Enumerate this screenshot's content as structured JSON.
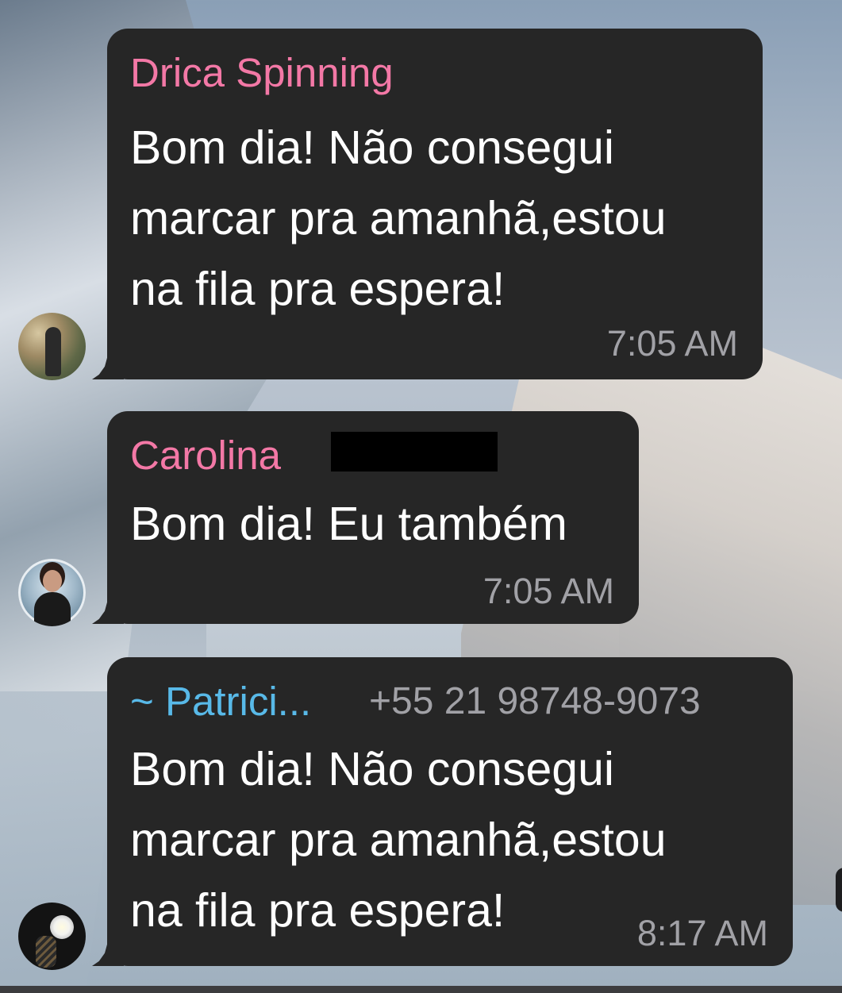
{
  "messages": [
    {
      "sender": "Drica Spinning",
      "text": "Bom dia! Não consegui\nmarcar pra amanhã,estou\nna fila pra espera!",
      "time": "7:05 AM",
      "sender_color": "#f378a6"
    },
    {
      "sender": "Carolina",
      "text": "Bom dia! Eu também",
      "time": "7:05 AM",
      "sender_color": "#f378a6",
      "redacted_surname": true
    },
    {
      "sender": "~ Patrici...",
      "phone": "+55 21 98748-9073",
      "text": "Bom dia! Não consegui\nmarcar pra amanhã,estou\nna fila pra espera!",
      "time": "8:17 AM",
      "sender_color": "#58b9e8"
    }
  ],
  "colors": {
    "bubble": "#262626",
    "message_text": "#ffffff",
    "meta_text": "#a1a1a6"
  },
  "icons": {
    "avatar_1": "avatar-woman-in-garden",
    "avatar_2": "avatar-woman-portrait",
    "avatar_3": "avatar-cactus-flower"
  }
}
